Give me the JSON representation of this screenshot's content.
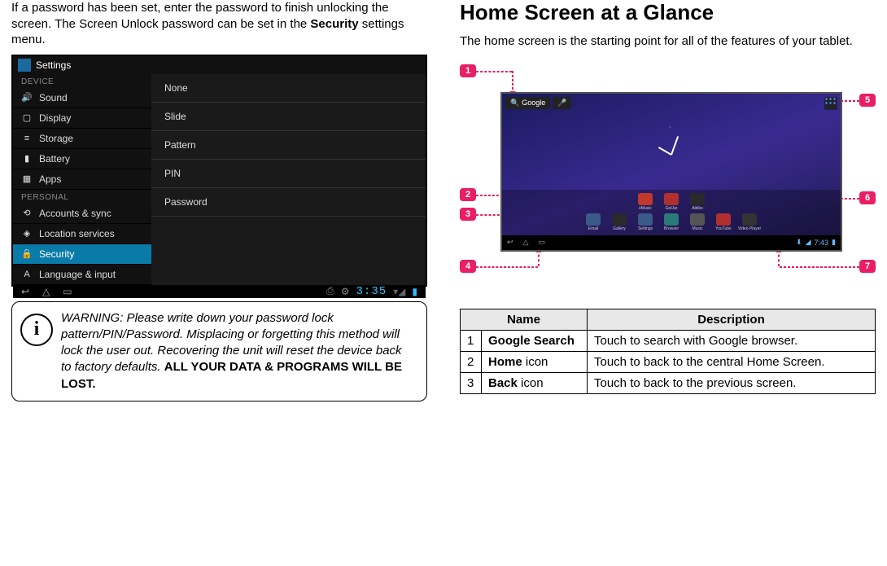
{
  "left": {
    "intro_pre": "If a password has been set, enter the password to finish unlocking the screen. The Screen Unlock password can be set in the ",
    "intro_bold": "Security",
    "intro_post": " settings menu.",
    "settings": {
      "title": "Settings",
      "device_header": "DEVICE",
      "personal_header": "PERSONAL",
      "items": [
        {
          "label": "Sound",
          "icon": "🔊"
        },
        {
          "label": "Display",
          "icon": "▢"
        },
        {
          "label": "Storage",
          "icon": "≡"
        },
        {
          "label": "Battery",
          "icon": "▮"
        },
        {
          "label": "Apps",
          "icon": "▦"
        }
      ],
      "personal_items": [
        {
          "label": "Accounts & sync",
          "icon": "⟲"
        },
        {
          "label": "Location services",
          "icon": "◈"
        },
        {
          "label": "Security",
          "icon": "🔒",
          "selected": true
        },
        {
          "label": "Language & input",
          "icon": "A"
        }
      ],
      "options": [
        "None",
        "Slide",
        "Pattern",
        "PIN",
        "Password"
      ],
      "nav": {
        "back": "↩",
        "home": "△",
        "recent": "▭",
        "time": "3:35"
      }
    },
    "warning": {
      "text": "WARNING: Please write down your password lock pattern/PIN/Password. Misplacing or forgetting this method will lock the user out. Recovering the unit will reset the device back to factory defaults. ",
      "bold": "ALL YOUR DATA & PROGRAMS WILL BE LOST",
      "tail": "."
    }
  },
  "right": {
    "heading": "Home Screen at a Glance",
    "sub": "The home screen is the starting point for all of the features of your tablet.",
    "callouts": [
      "1",
      "2",
      "3",
      "4",
      "5",
      "6",
      "7"
    ],
    "tablet": {
      "search_label": "Google",
      "apps_row1": [
        {
          "label": "eMusic",
          "color": "#c0392b"
        },
        {
          "label": "GetJar",
          "color": "#b03030"
        },
        {
          "label": "Aldiko",
          "color": "#2a2a2a"
        }
      ],
      "apps_row2": [
        {
          "label": "Email",
          "color": "#3a5a8a"
        },
        {
          "label": "Gallery",
          "color": "#2a2a2a"
        },
        {
          "label": "Settings",
          "color": "#3a5a8a"
        },
        {
          "label": "Browser",
          "color": "#2a7a7a"
        },
        {
          "label": "Music",
          "color": "#555"
        },
        {
          "label": "YouTube",
          "color": "#b03030"
        },
        {
          "label": "Video Player",
          "color": "#333"
        }
      ],
      "nav_time": "7:43"
    },
    "table": {
      "head_name": "Name",
      "head_desc": "Description",
      "rows": [
        {
          "n": "1",
          "name_b": "Google Search",
          "name_r": "",
          "desc": "Touch to search with Google browser."
        },
        {
          "n": "2",
          "name_b": "Home",
          "name_r": " icon",
          "desc": "Touch to back to the central Home Screen."
        },
        {
          "n": "3",
          "name_b": "Back",
          "name_r": " icon",
          "desc": "Touch to back to the previous screen."
        }
      ]
    }
  }
}
